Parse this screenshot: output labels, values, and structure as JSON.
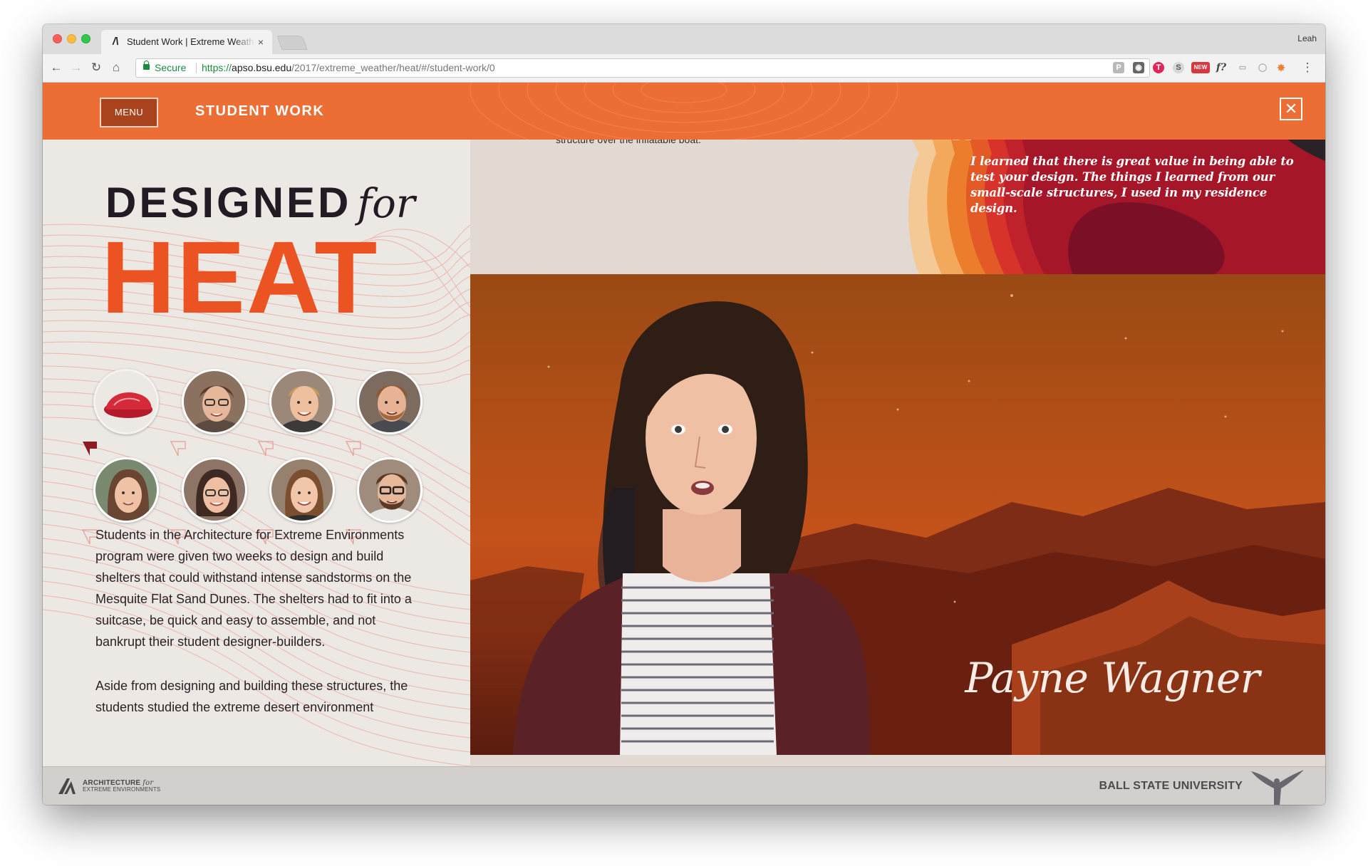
{
  "browser": {
    "tab_title": "Student Work | Extreme Weather",
    "tab_close": "×",
    "user_name": "Leah",
    "secure_label": "Secure",
    "url_scheme": "https://",
    "url_host": "apso.bsu.edu",
    "url_path": "/2017/extreme_weather/heat/#/student-work/0",
    "back": "←",
    "forward": "→",
    "reload": "↻",
    "home": "⌂",
    "star": "☆",
    "menu": "⋮",
    "extensions": [
      "P",
      "◉",
      "T",
      "S",
      "NEW",
      "f?",
      "▭",
      "◯",
      "✸"
    ]
  },
  "header": {
    "menu_label": "MENU",
    "section_title": "STUDENT WORK",
    "close_label": "✕"
  },
  "hero": {
    "line1": "DESIGNED",
    "line1_italic": "for",
    "line2": "HEAT"
  },
  "students": [
    {
      "name": "selected-structure",
      "selected": true
    },
    {
      "name": "student-2"
    },
    {
      "name": "student-3"
    },
    {
      "name": "student-4"
    },
    {
      "name": "student-5"
    },
    {
      "name": "student-6"
    },
    {
      "name": "student-7"
    },
    {
      "name": "student-8"
    }
  ],
  "intro": {
    "paragraph1": "Students in the Architecture for Extreme Environments program were given two weeks to design and build shelters that could withstand intense sandstorms on the Mesquite Flat Sand Dunes. The shelters had to fit into a suitcase, be quick and easy to assemble, and not bankrupt their student designer-builders.",
    "paragraph2": "Aside from designing and building these structures, the students studied the extreme desert environment"
  },
  "student_panel": {
    "cut_text": "structure over the inflatable boat.",
    "quote_mark": "“",
    "quote": "I learned that there is great value in being able to test your design. The things I learned from our small-scale structures, I used in my residence design.",
    "person_name": "Payne Wagner"
  },
  "footer": {
    "brand_line1": "ARCHITECTURE",
    "brand_for": "for",
    "brand_line2": "EXTREME ENVIRONMENTS",
    "university": "BALL STATE UNIVERSITY"
  },
  "colors": {
    "header_orange": "#ec6e35",
    "menu_brown": "#a8431d",
    "heat_orange": "#ec5322",
    "heading_dark": "#231b24",
    "quote_red": "#7a0f26"
  }
}
